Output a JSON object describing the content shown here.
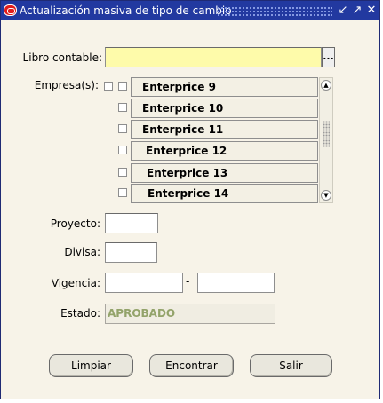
{
  "window": {
    "title": "Actualización masiva de tipo de cambio",
    "icon": "oracle-icon",
    "controls": [
      "minimize-icon",
      "maximize-icon",
      "close-icon"
    ]
  },
  "form": {
    "libro": {
      "label": "Libro contable:",
      "value": "",
      "lov_label": "..."
    },
    "empresa": {
      "label": "Empresa(s):",
      "items": [
        {
          "name": "Enterprice 9"
        },
        {
          "name": "Enterprice 10"
        },
        {
          "name": "Enterprice 11"
        },
        {
          "name": "Enterprice 12"
        },
        {
          "name": "Enterprice 13"
        },
        {
          "name": "Enterprice 14"
        }
      ]
    },
    "proyecto": {
      "label": "Proyecto:",
      "value": ""
    },
    "divisa": {
      "label": "Divisa:",
      "value": ""
    },
    "vigencia": {
      "label": "Vigencia:",
      "from": "",
      "separator": "-",
      "to": ""
    },
    "estado": {
      "label": "Estado:",
      "value": "APROBADO"
    }
  },
  "buttons": {
    "limpiar": "Limpiar",
    "encontrar": "Encontrar",
    "salir": "Salir"
  },
  "colors": {
    "titlebar": "#2239a0",
    "window_bg": "#f7f3e8",
    "required_field": "#fefbaa",
    "status_text": "#93a36a"
  }
}
